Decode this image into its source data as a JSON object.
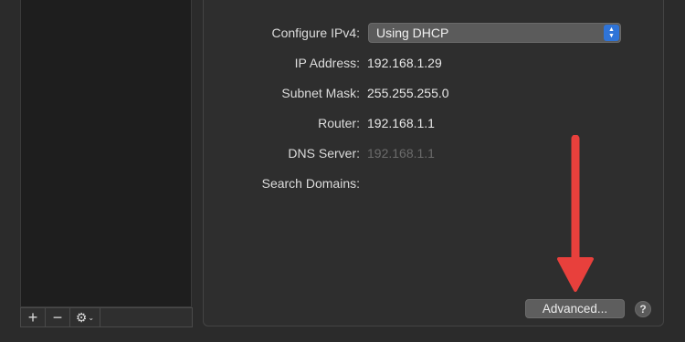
{
  "sidebar": {
    "add_icon": "+",
    "remove_icon": "−",
    "gear_icon": "⚙",
    "chevron_icon": "⌄"
  },
  "settings": {
    "configure_label": "Configure IPv4:",
    "configure_value": "Using DHCP",
    "ip_label": "IP Address:",
    "ip_value": "192.168.1.29",
    "subnet_label": "Subnet Mask:",
    "subnet_value": "255.255.255.0",
    "router_label": "Router:",
    "router_value": "192.168.1.1",
    "dns_label": "DNS Server:",
    "dns_value": "192.168.1.1",
    "search_label": "Search Domains:",
    "search_value": ""
  },
  "footer": {
    "advanced_label": "Advanced...",
    "help_label": "?"
  },
  "colors": {
    "accent": "#2f74d8",
    "arrow": "#e8403c",
    "dim_text": "#6b6b6b"
  }
}
